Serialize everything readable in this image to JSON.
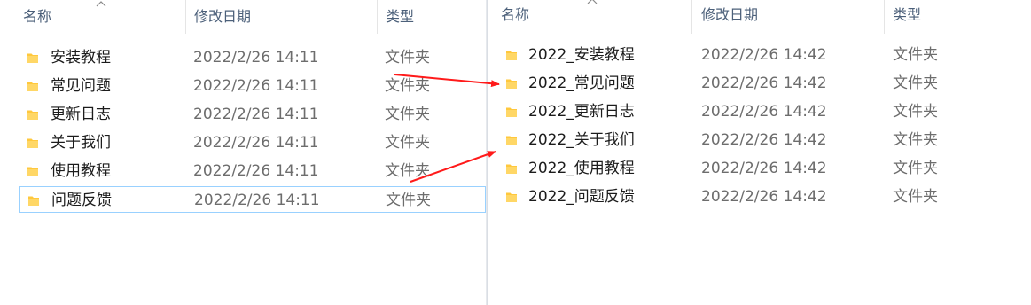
{
  "left_panel": {
    "columns": {
      "name": "名称",
      "modified": "修改日期",
      "type": "类型"
    },
    "rows": [
      {
        "name": "安装教程",
        "modified": "2022/2/26 14:11",
        "type": "文件夹"
      },
      {
        "name": "常见问题",
        "modified": "2022/2/26 14:11",
        "type": "文件夹"
      },
      {
        "name": "更新日志",
        "modified": "2022/2/26 14:11",
        "type": "文件夹"
      },
      {
        "name": "关于我们",
        "modified": "2022/2/26 14:11",
        "type": "文件夹"
      },
      {
        "name": "使用教程",
        "modified": "2022/2/26 14:11",
        "type": "文件夹"
      },
      {
        "name": "问题反馈",
        "modified": "2022/2/26 14:11",
        "type": "文件夹"
      }
    ],
    "selected_row": 5
  },
  "right_panel": {
    "columns": {
      "name": "名称",
      "modified": "修改日期",
      "type": "类型"
    },
    "rows": [
      {
        "name": "2022_安装教程",
        "modified": "2022/2/26 14:42",
        "type": "文件夹"
      },
      {
        "name": "2022_常见问题",
        "modified": "2022/2/26 14:42",
        "type": "文件夹"
      },
      {
        "name": "2022_更新日志",
        "modified": "2022/2/26 14:42",
        "type": "文件夹"
      },
      {
        "name": "2022_关于我们",
        "modified": "2022/2/26 14:42",
        "type": "文件夹"
      },
      {
        "name": "2022_使用教程",
        "modified": "2022/2/26 14:42",
        "type": "文件夹"
      },
      {
        "name": "2022_问题反馈",
        "modified": "2022/2/26 14:42",
        "type": "文件夹"
      }
    ]
  },
  "colors": {
    "annotation_arrow": "#ff1a1a",
    "folder": "#ffc83d",
    "selection_border": "#99d1ff"
  },
  "icons": {
    "folder": "folder-icon",
    "sort": "sort-up-icon"
  }
}
